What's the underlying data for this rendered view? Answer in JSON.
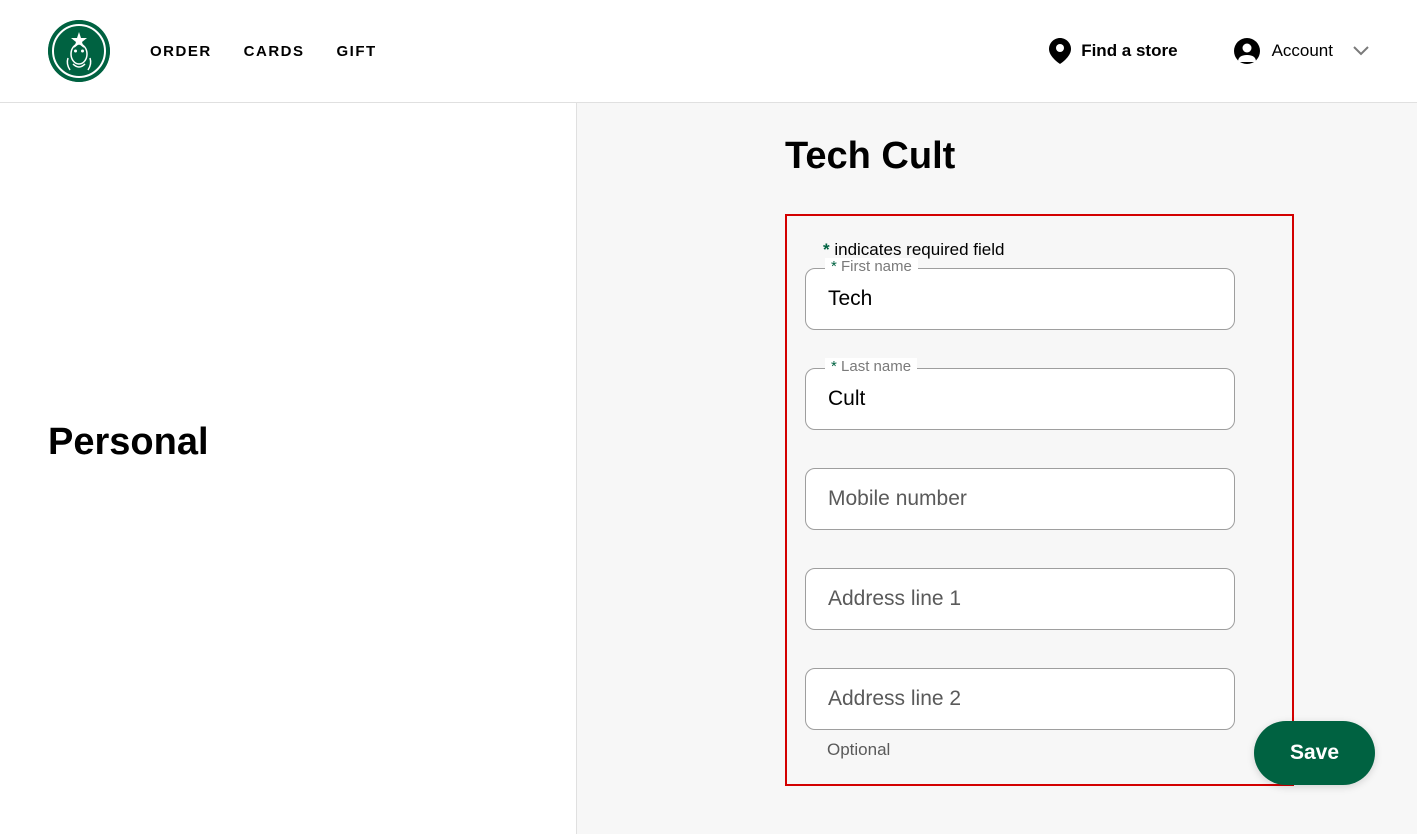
{
  "header": {
    "nav": {
      "order": "ORDER",
      "cards": "CARDS",
      "gift": "GIFT"
    },
    "find_store": "Find a store",
    "account": "Account"
  },
  "sidebar": {
    "title": "Personal"
  },
  "page": {
    "title": "Tech Cult",
    "required_note_prefix": "*",
    "required_note_text": " indicates required field"
  },
  "form": {
    "first_name": {
      "label_prefix": "* ",
      "label": "First name",
      "value": "Tech"
    },
    "last_name": {
      "label_prefix": "* ",
      "label": "Last name",
      "value": "Cult"
    },
    "mobile": {
      "placeholder": "Mobile number"
    },
    "address1": {
      "placeholder": "Address line 1"
    },
    "address2": {
      "placeholder": "Address line 2",
      "helper": "Optional"
    }
  },
  "actions": {
    "save": "Save"
  }
}
